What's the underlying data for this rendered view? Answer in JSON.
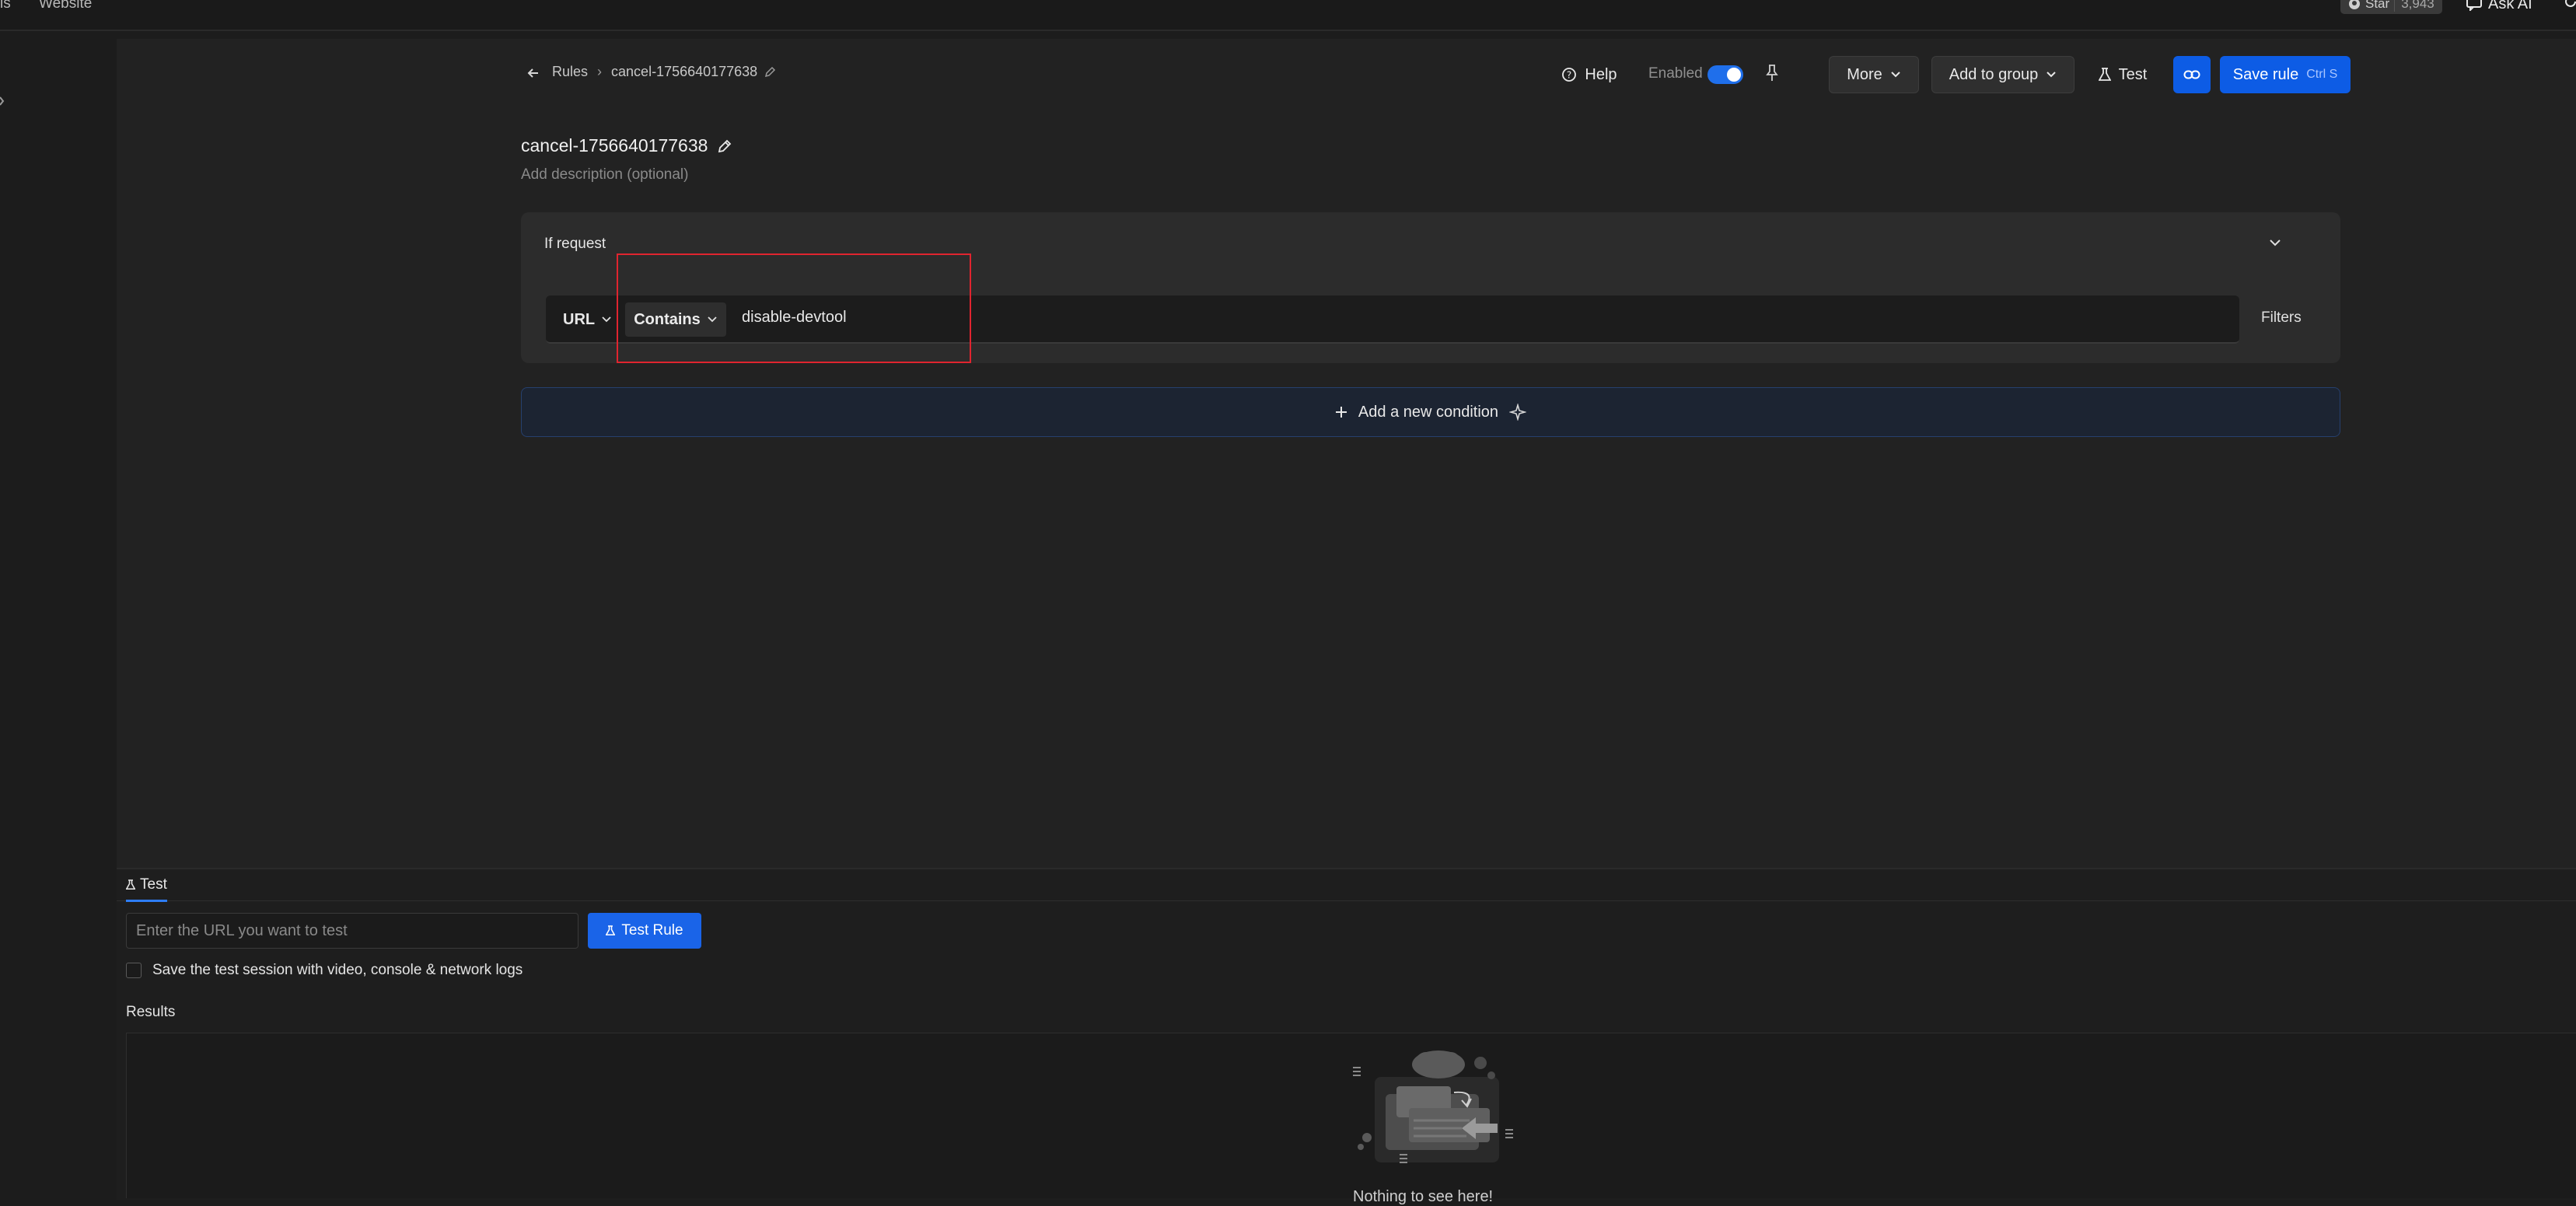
{
  "topbar": {
    "nav_left": "ls",
    "nav_website": "Website",
    "star_label": "Star",
    "star_count": "3,943",
    "ask_ai": "Ask AI"
  },
  "header": {
    "breadcrumb_rules": "Rules",
    "breadcrumb_sep": "›",
    "breadcrumb_current": "cancel-1756640177638",
    "help": "Help",
    "enabled": "Enabled",
    "more": "More",
    "add_to_group": "Add to group",
    "test": "Test",
    "save_rule": "Save rule",
    "save_shortcut": "Ctrl S"
  },
  "rule": {
    "title": "cancel-1756640177638",
    "description_placeholder": "Add description (optional)"
  },
  "condition": {
    "if_request": "If request",
    "source_key": "URL",
    "operator": "Contains",
    "value": "disable-devtool",
    "filters": "Filters"
  },
  "add_condition": {
    "label": "Add a new condition"
  },
  "test_panel": {
    "tab_label": "Test",
    "url_placeholder": "Enter the URL you want to test",
    "test_rule_button": "Test Rule",
    "save_session_label": "Save the test session with video, console & network logs",
    "results_label": "Results",
    "empty_text": "Nothing to see here!"
  },
  "colors": {
    "accent": "#0d5ce5",
    "highlight": "#e0242f",
    "background": "#1c1c1c"
  }
}
